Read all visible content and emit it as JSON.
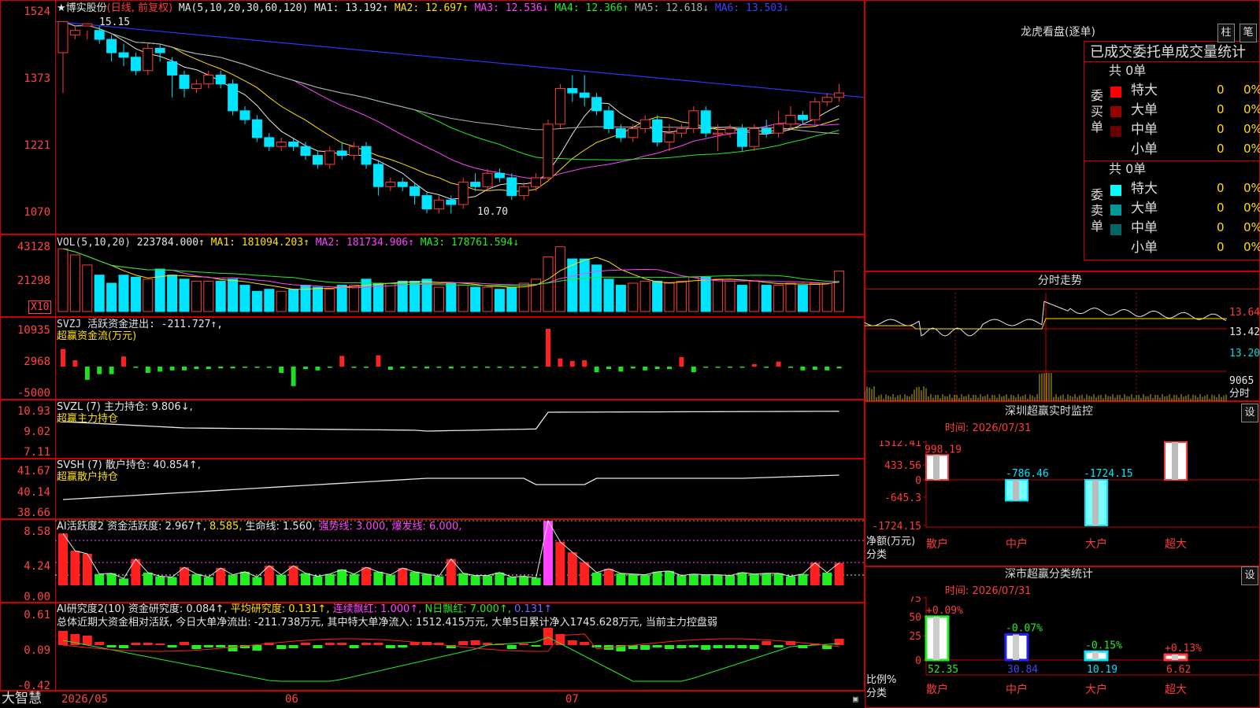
{
  "brand": "大智慧",
  "main_panel": {
    "stock": "★博实股份",
    "period": "(日线, 前复权)",
    "ma_params": "MA(5,10,20,30,60,120)",
    "mas": [
      {
        "label": "MA1: 13.192↑",
        "color": "#e6e6e6"
      },
      {
        "label": "MA2: 12.697↑",
        "color": "#ffe000"
      },
      {
        "label": "MA3: 12.536↓",
        "color": "#ff44ff"
      },
      {
        "label": "MA4: 12.366↑",
        "color": "#22ee22"
      },
      {
        "label": "MA5: 12.618↓",
        "color": "#b0b0b0"
      },
      {
        "label": "MA6: 13.503↓",
        "color": "#4040ff"
      }
    ],
    "y_ticks": [
      "1524",
      "1373",
      "1221",
      "1070"
    ],
    "high_mark": "15.15",
    "low_mark": "10.70",
    "x_labels": [
      "2026/05",
      "06",
      "07"
    ]
  },
  "vol_panel": {
    "header": [
      {
        "label": "VOL(5,10,20)",
        "color": "#dddddd"
      },
      {
        "label": "223784.000↑",
        "color": "#e6e6e6"
      },
      {
        "label": "MA1: 181094.203↑",
        "color": "#ffe000"
      },
      {
        "label": "MA2: 181734.906↑",
        "color": "#ff44ff"
      },
      {
        "label": "MA3: 178761.594↓",
        "color": "#22ee22"
      }
    ],
    "y_ticks": [
      "43128",
      "21298"
    ],
    "unit": "X10"
  },
  "svzj_panel": {
    "header": [
      {
        "label": "SVZJ",
        "color": "#dddddd"
      },
      {
        "label": "活跃资金进出: -211.727↑,",
        "color": "#e6e6e6"
      }
    ],
    "subtitle": "超赢资金流(万元)",
    "y_ticks": [
      "10935",
      "2968",
      "-5000"
    ]
  },
  "svzl_panel": {
    "header": [
      {
        "label": "SVZL (7) 主力持仓: 9.806↓,",
        "color": "#e6e6e6"
      }
    ],
    "subtitle": "超赢主力持仓",
    "y_ticks": [
      "10.93",
      "9.02",
      "7.11"
    ]
  },
  "svsh_panel": {
    "header": [
      {
        "label": "SVSH (7) 散户持仓: 40.854↑,",
        "color": "#e6e6e6"
      }
    ],
    "subtitle": "超赢散户持仓",
    "y_ticks": [
      "41.67",
      "40.14",
      "38.66"
    ]
  },
  "ai_active_panel": {
    "header": [
      {
        "label": "AI活跃度2 资金活跃度: 2.967↑,",
        "color": "#e6e6e6"
      },
      {
        "label": "8.585,",
        "color": "#ffe000"
      },
      {
        "label": "生命线: 1.560,",
        "color": "#e6e6e6"
      },
      {
        "label": "强势线: 3.000,",
        "color": "#ff44ff"
      },
      {
        "label": "爆发线: 6.000,",
        "color": "#ff44ff"
      }
    ],
    "y_ticks": [
      "8.58",
      "4.24",
      "0.00"
    ]
  },
  "ai_research_panel": {
    "header": [
      {
        "label": "AI研究度2(10) 资金研究度: 0.084↑,",
        "color": "#e6e6e6"
      },
      {
        "label": "平均研究度: 0.131↑,",
        "color": "#ffe000"
      },
      {
        "label": "连续飘红: 1.000↑,",
        "color": "#ff44ff"
      },
      {
        "label": "N日飘红: 7.000↑,",
        "color": "#22ee22"
      },
      {
        "label": "0.131↑",
        "color": "#6c6cff"
      }
    ],
    "summary": "总体近期大资金相对活跃, 今日大单净流出: -211.738万元, 其中特大单净流入: 1512.415万元, 大单5日累计净入1745.628万元, 当前主力控盘弱",
    "y_ticks": [
      "0.61",
      "0.09",
      "-0.42"
    ]
  },
  "dragon_tiger": {
    "title": "龙虎看盘(逐单)",
    "tab_a": "柱",
    "tab_b": "笔",
    "subtitle": "已成交委托单成交量统计",
    "buy_label": "委买单",
    "sell_label": "委卖单",
    "buy_total": "共 0单",
    "sell_total": "共 0单",
    "buy_rows": [
      {
        "name": "特大",
        "count": "0",
        "pct": "0%",
        "color": "#ff0000"
      },
      {
        "name": "大单",
        "count": "0",
        "pct": "0%",
        "color": "#990000"
      },
      {
        "name": "中单",
        "count": "0",
        "pct": "0%",
        "color": "#660000"
      },
      {
        "name": "小单",
        "count": "0",
        "pct": "0%",
        "color": ""
      }
    ],
    "sell_rows": [
      {
        "name": "特大",
        "count": "0",
        "pct": "0%",
        "color": "#00ffff"
      },
      {
        "name": "大单",
        "count": "0",
        "pct": "0%",
        "color": "#009999"
      },
      {
        "name": "中单",
        "count": "0",
        "pct": "0%",
        "color": "#006666"
      },
      {
        "name": "小单",
        "count": "0",
        "pct": "0%",
        "color": ""
      }
    ]
  },
  "intraday": {
    "title": "分时走势",
    "prices": [
      "13.64",
      "13.42",
      "13.20"
    ],
    "volume": "9065",
    "unit": "分时"
  },
  "monitor": {
    "title": "深圳超赢实时监控",
    "set": "设",
    "time": "时间: 2026/07/31",
    "y_ticks": [
      "1512.41",
      "433.56",
      "0",
      "-645.3",
      "-1724.15"
    ],
    "ylabel": "净额(万元)",
    "xlabel": "分类",
    "bars": [
      {
        "cat": "散户",
        "value": 998.19,
        "label": "998.19"
      },
      {
        "cat": "中户",
        "value": -786.46,
        "label": "-786.46"
      },
      {
        "cat": "大户",
        "value": -1724.15,
        "label": "-1724.15"
      },
      {
        "cat": "超大",
        "value": 1512.41,
        "label": "1512.41"
      }
    ]
  },
  "classify": {
    "title": "深市超赢分类统计",
    "set": "设",
    "time": "时间: 2026/07/31",
    "y_ticks": [
      "75",
      "50",
      "25",
      "0"
    ],
    "ylabel": "比例%",
    "xlabel": "分类",
    "bars": [
      {
        "cat": "散户",
        "value": 52.35,
        "label": "52.35",
        "chg": "+0.09%"
      },
      {
        "cat": "中户",
        "value": 30.84,
        "label": "30.84",
        "chg": "-0.07%"
      },
      {
        "cat": "大户",
        "value": 10.19,
        "label": "10.19",
        "chg": "-0.15%"
      },
      {
        "cat": "超大",
        "value": 6.62,
        "label": "6.62",
        "chg": "+0.13%"
      }
    ]
  },
  "chart_data": [
    {
      "type": "candlestick",
      "title": "博实股份 日线",
      "y_ticks": [
        "1524",
        "1373",
        "1221",
        "1070"
      ],
      "high": 15.15,
      "low": 10.7,
      "candles": [
        [
          14.5,
          15.2,
          14.9,
          13.6
        ],
        [
          14.9,
          15.0,
          15.1,
          14.8
        ],
        [
          15.1,
          15.15,
          15.0,
          14.8
        ],
        [
          15.0,
          14.8,
          15.1,
          14.7
        ],
        [
          14.8,
          14.5,
          14.9,
          14.3
        ],
        [
          14.5,
          14.4,
          14.7,
          14.2
        ],
        [
          14.4,
          14.1,
          14.5,
          14.0
        ],
        [
          14.1,
          14.6,
          14.7,
          14.0
        ],
        [
          14.6,
          14.5,
          14.7,
          14.3
        ],
        [
          14.3,
          14.0,
          14.4,
          13.5
        ],
        [
          14.0,
          13.7,
          14.1,
          13.5
        ],
        [
          13.7,
          13.8,
          13.9,
          13.6
        ],
        [
          13.8,
          14.0,
          14.1,
          13.7
        ],
        [
          14.0,
          13.8,
          14.1,
          13.7
        ],
        [
          13.8,
          13.2,
          13.9,
          13.1
        ],
        [
          13.2,
          13.0,
          13.3,
          12.9
        ],
        [
          13.0,
          12.6,
          13.1,
          12.5
        ],
        [
          12.6,
          12.4,
          12.7,
          12.3
        ],
        [
          12.4,
          12.5,
          12.6,
          12.3
        ],
        [
          12.5,
          12.4,
          12.6,
          12.3
        ],
        [
          12.4,
          12.2,
          12.5,
          12.1
        ],
        [
          12.2,
          12.0,
          12.3,
          11.9
        ],
        [
          12.0,
          12.3,
          12.4,
          11.9
        ],
        [
          12.3,
          12.2,
          12.5,
          12.1
        ],
        [
          12.2,
          12.4,
          12.5,
          12.1
        ],
        [
          12.4,
          12.0,
          12.5,
          11.9
        ],
        [
          12.0,
          11.5,
          12.1,
          11.3
        ],
        [
          11.5,
          11.6,
          11.7,
          11.4
        ],
        [
          11.6,
          11.5,
          11.7,
          11.4
        ],
        [
          11.5,
          11.3,
          11.6,
          11.1
        ],
        [
          11.3,
          11.0,
          11.4,
          10.9
        ],
        [
          11.0,
          11.2,
          11.3,
          10.9
        ],
        [
          11.2,
          11.1,
          11.3,
          10.9
        ],
        [
          11.1,
          11.6,
          11.7,
          11.0
        ],
        [
          11.6,
          11.5,
          11.8,
          11.4
        ],
        [
          11.5,
          11.8,
          11.9,
          11.4
        ],
        [
          11.8,
          11.7,
          11.9,
          11.6
        ],
        [
          11.7,
          11.3,
          11.8,
          11.2
        ],
        [
          11.3,
          11.5,
          11.6,
          11.2
        ],
        [
          11.5,
          11.7,
          11.8,
          11.4
        ],
        [
          11.7,
          12.9,
          13.0,
          11.6
        ],
        [
          12.9,
          13.7,
          13.8,
          12.8
        ],
        [
          13.7,
          13.6,
          14.0,
          13.4
        ],
        [
          13.6,
          13.5,
          14.0,
          13.3
        ],
        [
          13.5,
          13.2,
          13.6,
          13.1
        ],
        [
          13.2,
          12.8,
          13.3,
          12.7
        ],
        [
          12.8,
          12.6,
          12.9,
          12.5
        ],
        [
          12.6,
          12.8,
          12.9,
          12.5
        ],
        [
          12.8,
          13.0,
          13.1,
          12.7
        ],
        [
          13.0,
          12.5,
          13.1,
          12.4
        ],
        [
          12.5,
          12.7,
          12.9,
          12.3
        ],
        [
          12.7,
          12.8,
          12.9,
          12.6
        ],
        [
          12.8,
          13.2,
          13.3,
          12.7
        ],
        [
          13.2,
          12.7,
          13.3,
          12.6
        ],
        [
          12.7,
          12.7,
          12.9,
          12.3
        ],
        [
          12.7,
          12.8,
          12.9,
          12.6
        ],
        [
          12.8,
          12.4,
          12.9,
          12.3
        ],
        [
          12.4,
          12.8,
          12.9,
          12.3
        ],
        [
          12.8,
          12.7,
          13.0,
          12.6
        ],
        [
          12.7,
          12.9,
          13.2,
          12.6
        ],
        [
          12.9,
          13.1,
          13.3,
          12.8
        ],
        [
          13.1,
          13.0,
          13.2,
          12.9
        ],
        [
          13.0,
          13.4,
          13.5,
          12.9
        ],
        [
          13.4,
          13.5,
          13.6,
          13.3
        ],
        [
          13.5,
          13.6,
          13.8,
          13.4
        ]
      ]
    },
    {
      "type": "bar",
      "title": "VOL(5,10,20)",
      "values": [
        31,
        28,
        23,
        18,
        14,
        18,
        17,
        16,
        21,
        18,
        16,
        15,
        15,
        15,
        16,
        13,
        10,
        11,
        10,
        11,
        13,
        12,
        11,
        13,
        13,
        16,
        14,
        14,
        15,
        15,
        16,
        12,
        14,
        13,
        12,
        12,
        11,
        12,
        14,
        16,
        27,
        32,
        26,
        26,
        23,
        16,
        13,
        14,
        15,
        15,
        14,
        15,
        17,
        17,
        16,
        15,
        13,
        15,
        13,
        13,
        14,
        13,
        14,
        14,
        20
      ]
    },
    {
      "type": "bar",
      "title": "SVZJ 活跃资金进出",
      "values": [
        2800,
        1000,
        -2100,
        -1200,
        -1200,
        1600,
        -200,
        -1000,
        -800,
        -600,
        -600,
        -400,
        -400,
        -300,
        -300,
        -200,
        -200,
        -200,
        -1000,
        -3100,
        -400,
        -600,
        -200,
        1700,
        -200,
        -200,
        1800,
        -500,
        -300,
        -200,
        -300,
        -200,
        -300,
        -200,
        -200,
        -200,
        -200,
        -200,
        -200,
        -200,
        6000,
        1300,
        900,
        1000,
        -900,
        -400,
        -800,
        -300,
        -600,
        -400,
        -400,
        1500,
        -900,
        -100,
        -100,
        -100,
        -100,
        400,
        -200,
        800,
        -200,
        -600,
        -500,
        -600,
        -300
      ]
    },
    {
      "type": "bar",
      "title": "AI活跃度2",
      "values": [
        6.9,
        4.6,
        4.2,
        1.5,
        1.6,
        0.9,
        3.5,
        1.7,
        1.2,
        1.1,
        2.4,
        1.5,
        1.1,
        2.3,
        1.4,
        1.8,
        1.1,
        2.6,
        1.4,
        2.6,
        1.6,
        1.2,
        1.5,
        2.1,
        1.5,
        2.4,
        1.8,
        1.4,
        2.3,
        1.8,
        1.5,
        1.2,
        3.5,
        1.6,
        1.3,
        1.3,
        1.7,
        1.1,
        1.2,
        1.0,
        8.585,
        5.8,
        4.4,
        3.1,
        1.7,
        2.2,
        1.6,
        1.5,
        1.4,
        1.8,
        1.9,
        1.3,
        1.5,
        1.4,
        1.4,
        1.3,
        1.7,
        1.5,
        1.6,
        1.6,
        1.2,
        1.5,
        3.0,
        1.7,
        2.967
      ]
    }
  ]
}
